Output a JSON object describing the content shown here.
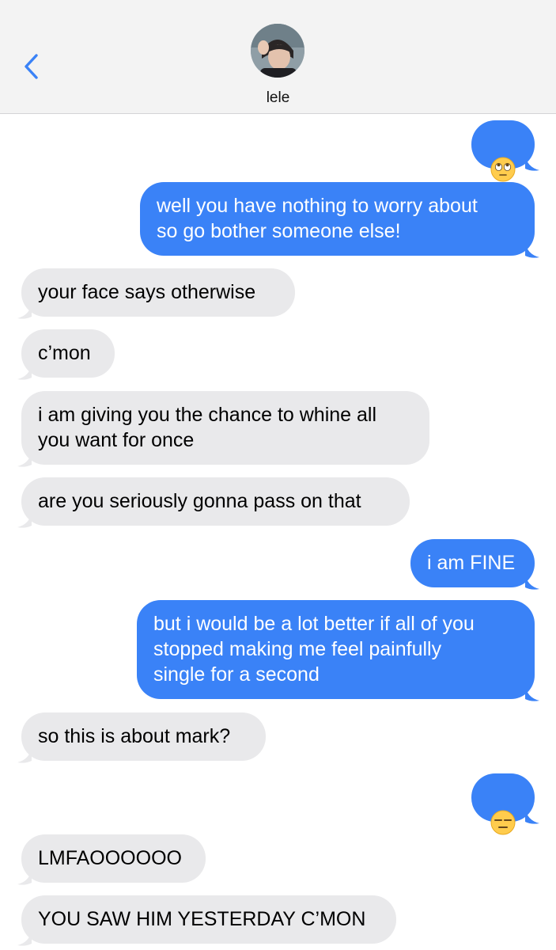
{
  "header": {
    "back_icon": "chevron-left-icon",
    "contact_name": "lele",
    "accent_color": "#3a82f7"
  },
  "colors": {
    "sent_bubble": "#3a82f7",
    "received_bubble": "#e9e9eb",
    "header_bg": "#f3f3f3"
  },
  "messages": [
    {
      "direction": "sent",
      "type": "emoji",
      "emoji": "face-with-rolling-eyes"
    },
    {
      "direction": "sent",
      "text": "well you have nothing to worry about\nso go bother someone else!"
    },
    {
      "direction": "received",
      "text": "your face says otherwise"
    },
    {
      "direction": "received",
      "text": "c’mon"
    },
    {
      "direction": "received",
      "text": "i am giving you the chance to whine all\nyou want for once"
    },
    {
      "direction": "received",
      "text": "are you seriously gonna pass on that"
    },
    {
      "direction": "sent",
      "text": "i am FINE"
    },
    {
      "direction": "sent",
      "text": "but i would be a lot better if all of you\nstopped making me feel painfully\nsingle for a second"
    },
    {
      "direction": "received",
      "text": "so this is about mark?"
    },
    {
      "direction": "sent",
      "type": "emoji",
      "emoji": "expressionless-face"
    },
    {
      "direction": "received",
      "text": "LMFAOOOOOO"
    },
    {
      "direction": "received",
      "text": "YOU SAW HIM YESTERDAY C’MON"
    }
  ]
}
